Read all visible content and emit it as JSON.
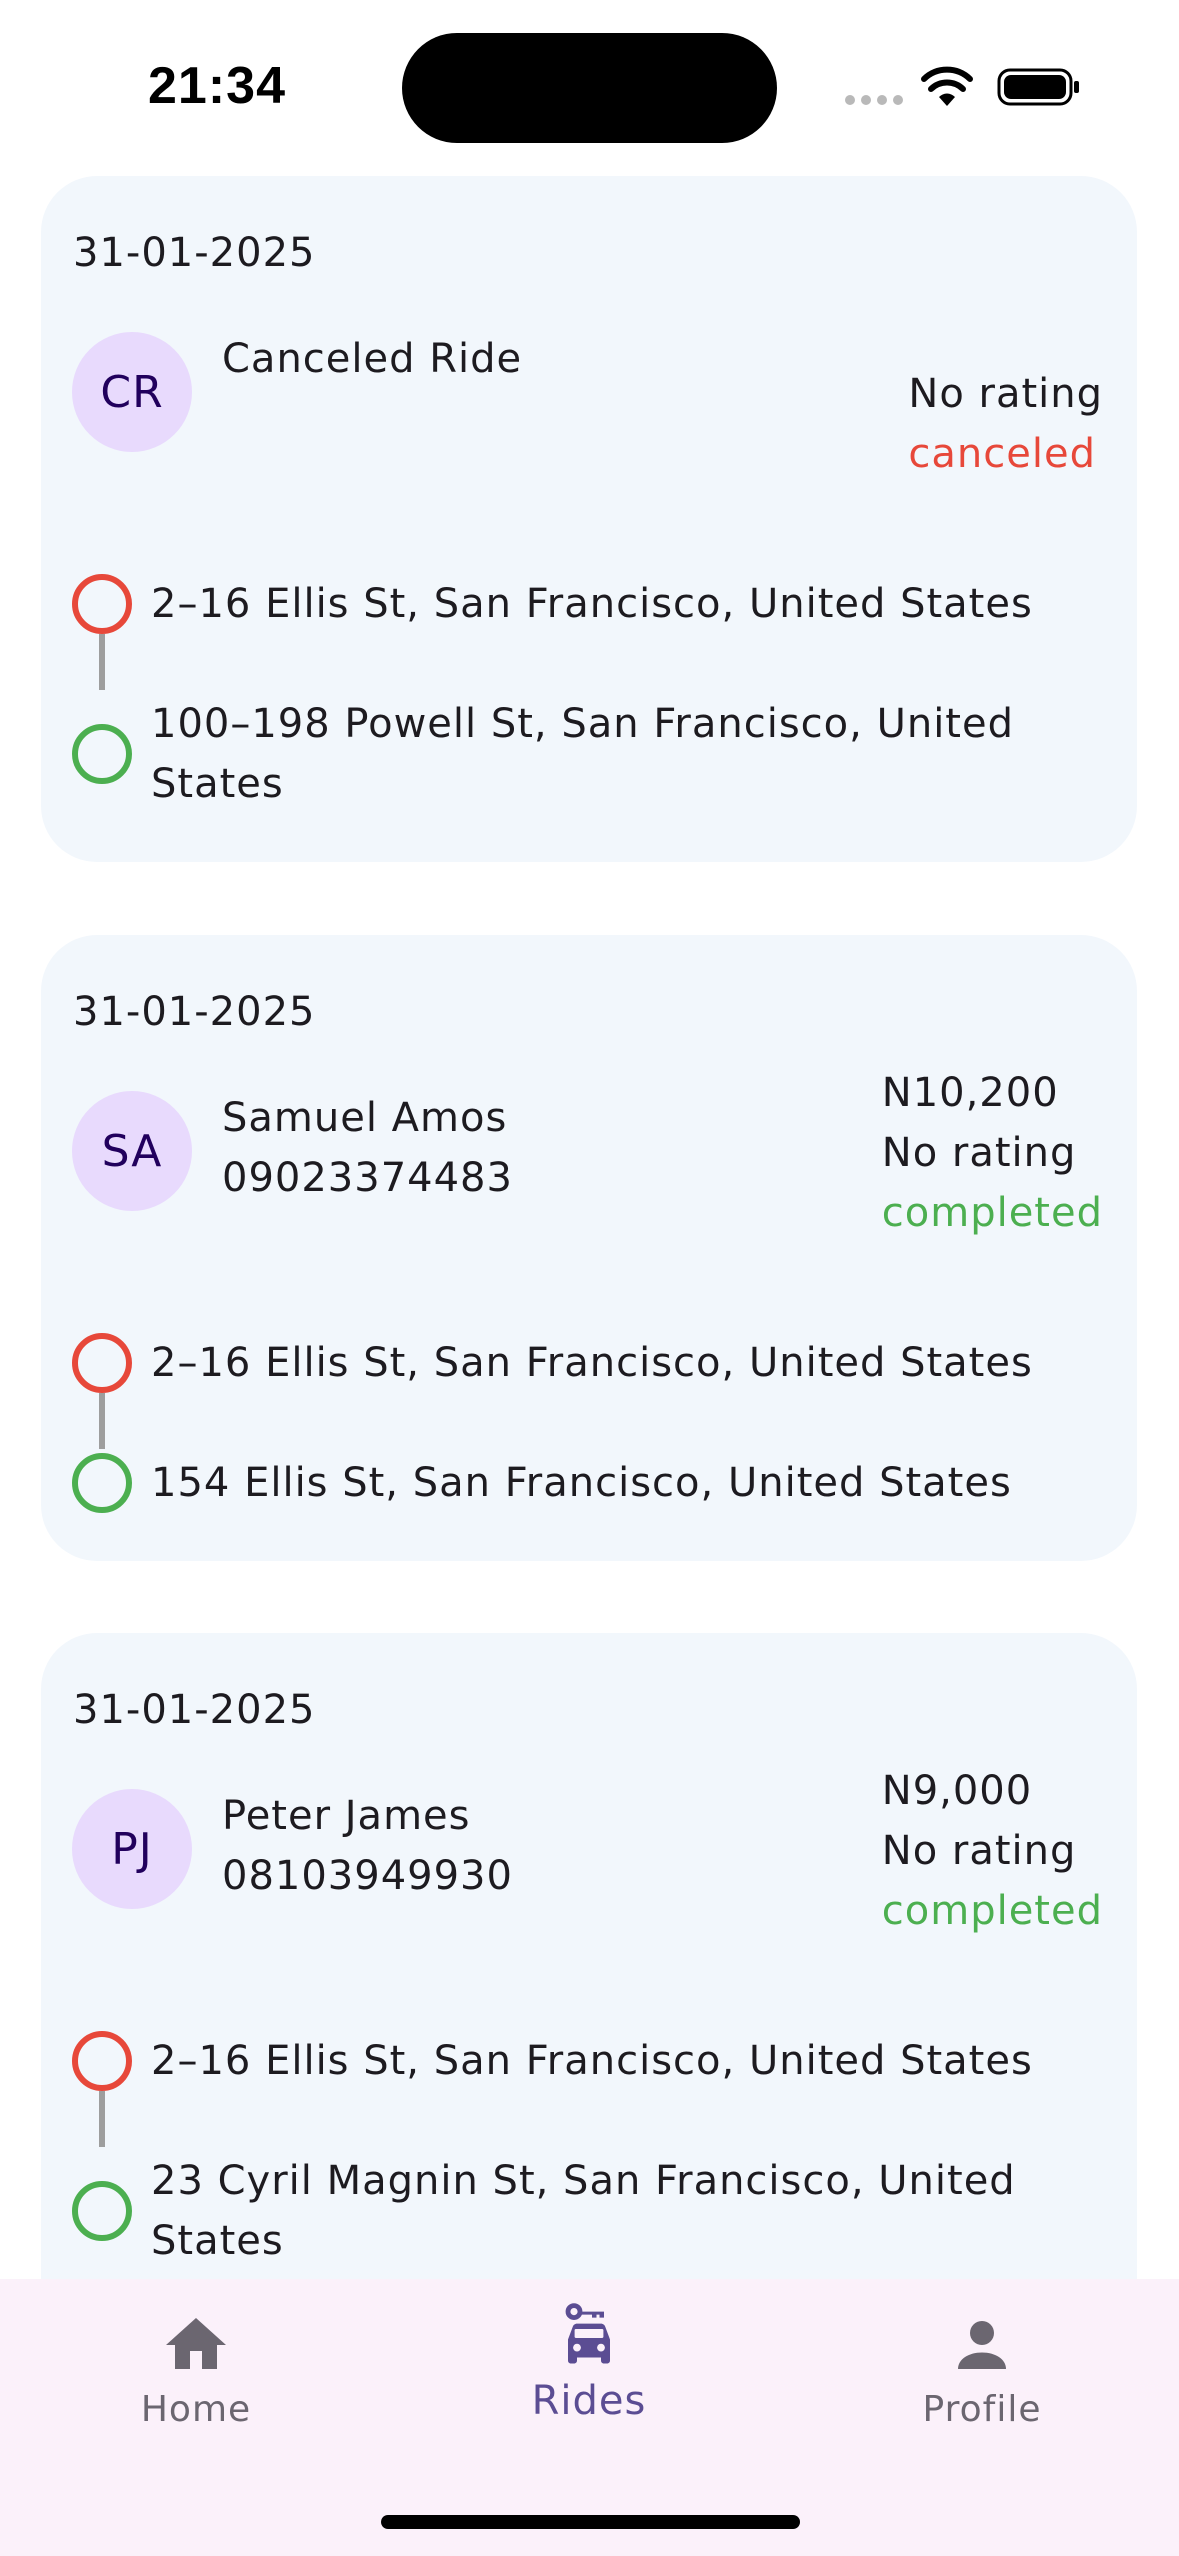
{
  "status_bar": {
    "time": "21:34"
  },
  "rides": [
    {
      "date": "31-01-2025",
      "initials": "CR",
      "name": "Canceled Ride",
      "phone": "",
      "price": "",
      "rating": "No rating",
      "status": "canceled",
      "pickup": "2–16 Ellis St, San Francisco, United States",
      "dropoff": "100–198 Powell St, San Francisco, United States"
    },
    {
      "date": "31-01-2025",
      "initials": "SA",
      "name": "Samuel Amos",
      "phone": "09023374483",
      "price": "N10,200",
      "rating": "No rating",
      "status": "completed",
      "pickup": "2–16 Ellis St, San Francisco, United States",
      "dropoff": "154 Ellis St, San Francisco, United States"
    },
    {
      "date": "31-01-2025",
      "initials": "PJ",
      "name": "Peter James",
      "phone": "08103949930",
      "price": "N9,000",
      "rating": "No rating",
      "status": "completed",
      "pickup": "2–16 Ellis St, San Francisco, United States",
      "dropoff": "23 Cyril Magnin St, San Francisco, United States"
    }
  ],
  "bottom_nav": {
    "items": [
      {
        "label": "Home",
        "icon": "home-icon"
      },
      {
        "label": "Rides",
        "icon": "car-key-icon"
      },
      {
        "label": "Profile",
        "icon": "person-icon"
      }
    ],
    "active": "Rides"
  },
  "colors": {
    "card_bg": "#f2f7fc",
    "avatar_bg": "#e8dafd",
    "canceled": "#e7483a",
    "completed": "#4caf50",
    "nav_active": "#5b4d93",
    "nav_bg": "#fbf1fa"
  }
}
